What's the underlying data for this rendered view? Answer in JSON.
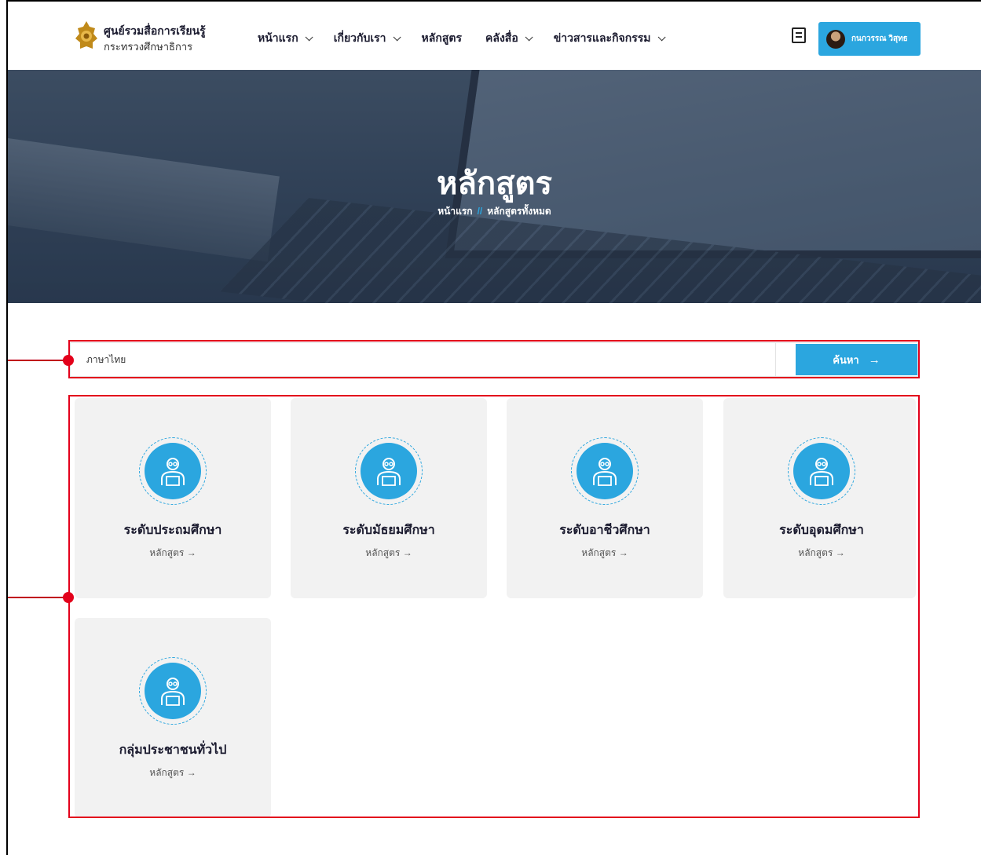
{
  "brand": {
    "title": "ศูนย์รวมสื่อการเรียนรู้",
    "subtitle": "กระทรวงศึกษาธิการ"
  },
  "nav": {
    "items": [
      {
        "label": "หน้าแรก",
        "dropdown": true
      },
      {
        "label": "เกี่ยวกับเรา",
        "dropdown": true
      },
      {
        "label": "หลักสูตร",
        "dropdown": false
      },
      {
        "label": "คลังสื่อ",
        "dropdown": true
      },
      {
        "label": "ข่าวสารและกิจกรรม",
        "dropdown": true
      }
    ]
  },
  "user": {
    "name": "กนกวรรณ วิสุทธ"
  },
  "hero": {
    "title": "หลักสูตร",
    "breadcrumb_home": "หน้าแรก",
    "breadcrumb_sep": "//",
    "breadcrumb_current": "หลักสูตรทั้งหมด"
  },
  "search": {
    "value": "ภาษาไทย",
    "button_label": "ค้นหา",
    "button_arrow": "→"
  },
  "cards": [
    {
      "title": "ระดับประถมศึกษา",
      "link": "หลักสูตร →"
    },
    {
      "title": "ระดับมัธยมศึกษา",
      "link": "หลักสูตร →"
    },
    {
      "title": "ระดับอาชีวศึกษา",
      "link": "หลักสูตร →"
    },
    {
      "title": "ระดับอุดมศึกษา",
      "link": "หลักสูตร →"
    },
    {
      "title": "กลุ่มประชาชนทั่วไป",
      "link": "หลักสูตร →"
    }
  ],
  "colors": {
    "accent": "#2ba6df",
    "annotation": "#e3001b"
  },
  "icons": {
    "card_icon": "teacher-with-glasses-icon",
    "header_icon": "book-icon"
  }
}
